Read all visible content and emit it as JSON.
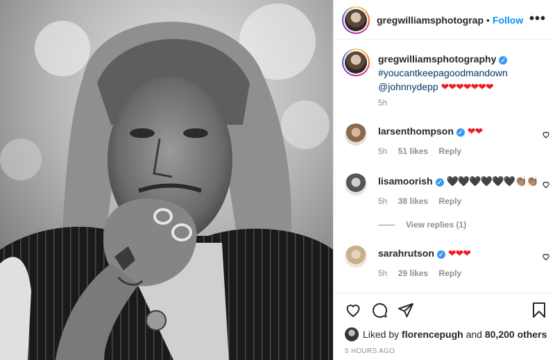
{
  "post": {
    "image_alt": "Black and white portrait photograph",
    "author": "gregwilliamsphotograpl",
    "follow_label": "Follow",
    "separator": "•",
    "more_label": "•••"
  },
  "caption": {
    "username": "gregwilliamsphotography",
    "hashtag": "#youcantkeepagoodmandown",
    "mention": "@johnnydepp",
    "hearts": "❤❤❤❤❤❤❤",
    "time": "5h"
  },
  "comments": [
    {
      "username": "larsenthompson",
      "text": "❤❤",
      "time": "5h",
      "likes": "51 likes",
      "reply": "Reply"
    },
    {
      "username": "lisamoorish",
      "text": "🖤🖤🖤🖤🖤🖤👏🏽👏🏽",
      "time": "5h",
      "likes": "38 likes",
      "reply": "Reply"
    },
    {
      "username": "sarahrutson",
      "text": "❤❤❤",
      "time": "5h",
      "likes": "29 likes",
      "reply": "Reply"
    }
  ],
  "view_replies": "View replies (1)",
  "actions": {
    "like": "heart-icon",
    "comment": "comment-icon",
    "share": "share-icon",
    "save": "bookmark-icon"
  },
  "likes_line": {
    "prefix": "Liked by",
    "user": "florencepugh",
    "and": "and",
    "others": "80,200 others"
  },
  "timestamp": "5 HOURS AGO",
  "colors": {
    "accent": "#0095f6",
    "verified": "#3897f0",
    "heart": "#ed1c24",
    "muted": "#8e8e8e"
  }
}
